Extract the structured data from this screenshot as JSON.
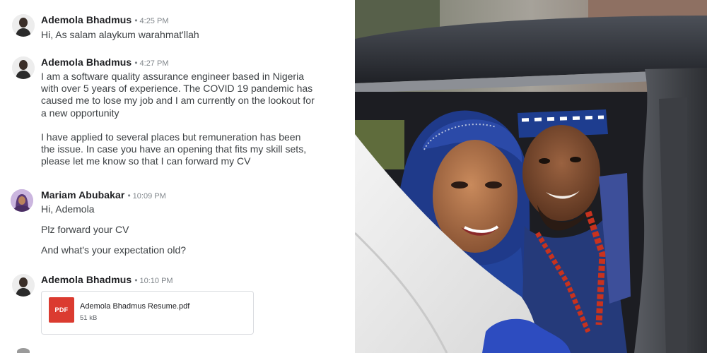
{
  "chat": {
    "messages": [
      {
        "sender": "Ademola Bhadmus",
        "separator": "•",
        "time": "4:25 PM",
        "avatar_icon": "person-avatar-icon",
        "lines": [
          "Hi, As salam alaykum warahmat'llah"
        ]
      },
      {
        "sender": "Ademola Bhadmus",
        "separator": "•",
        "time": "4:27 PM",
        "avatar_icon": "person-avatar-icon",
        "lines": [
          "I am a software quality assurance engineer based in Nigeria",
          "with over 5 years of experience. The COVID 19 pandemic has",
          "caused me to lose my job and I am currently on the lookout for",
          "a new opportunity",
          "I have applied to several places but remuneration has been",
          "the issue. In case you have an opening that fits my skill sets,",
          "please let me know so that I can forward my CV"
        ]
      },
      {
        "sender": "Mariam Abubakar",
        "separator": "•",
        "time": "10:09 PM",
        "avatar_icon": "person-avatar-icon",
        "lines": [
          "Hi, Ademola",
          "Plz forward your CV",
          "And what's your expectation old?"
        ]
      },
      {
        "sender": "Ademola Bhadmus",
        "separator": "•",
        "time": "10:10 PM",
        "avatar_icon": "person-avatar-icon",
        "attachment": {
          "badge": "PDF",
          "file_name": "Ademola Bhadmus Resume.pdf",
          "file_size": "51 kB",
          "icon": "pdf-file-icon"
        }
      }
    ]
  },
  "colors": {
    "name_text": "#202124",
    "body_text": "#3c4043",
    "meta_text": "#80868b",
    "pdf_red": "#db3b30",
    "card_border": "#dadce0"
  }
}
